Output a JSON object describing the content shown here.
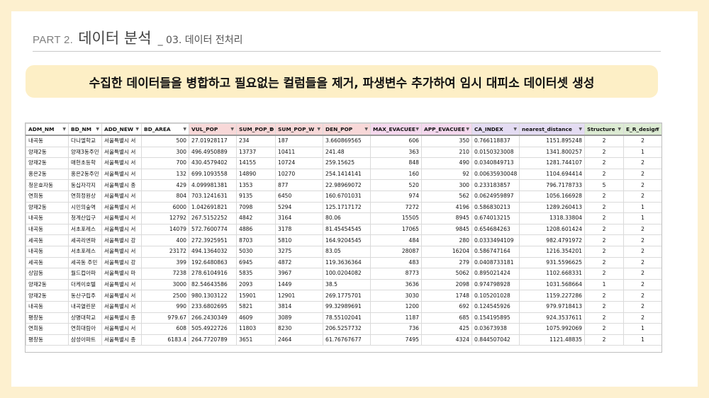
{
  "header": {
    "part": "PART 2.",
    "title": "데이터 분석",
    "subtitle": "_ 03. 데이터 전처리"
  },
  "banner": "수집한 데이터들을 병합하고 필요없는 컬럼들을 제거, 파생변수 추가하여 임시 대피소 데이터셋 생성",
  "table": {
    "columns": [
      {
        "name": "ADM_NM",
        "color": "#ffffff"
      },
      {
        "name": "BD_NM",
        "color": "#ffffff"
      },
      {
        "name": "ADD_NEW",
        "color": "#ffffff"
      },
      {
        "name": "BD_AREA",
        "color": "#ffffff"
      },
      {
        "name": "VUL_POP",
        "color": "#f8d8d8"
      },
      {
        "name": "SUM_POP_D",
        "color": "#f8d8d8"
      },
      {
        "name": "SUM_POP_W",
        "color": "#f8d8d8"
      },
      {
        "name": "DEN_POP",
        "color": "#f8d8d8"
      },
      {
        "name": "MAX_EVACUEE",
        "color": "#f5d8ee"
      },
      {
        "name": "APP_EVACUEE",
        "color": "#f5d8ee"
      },
      {
        "name": "CA_INDEX",
        "color": "#e4dcf3"
      },
      {
        "name": "nearest_distance",
        "color": "#e4dcf3"
      },
      {
        "name": "Structure",
        "color": "#dcebd3"
      },
      {
        "name": "E_R_design",
        "color": "#dcebd3"
      }
    ],
    "rows": [
      [
        "내곡동",
        "다니엘학교",
        "서울특별시 서",
        "500",
        "27.01928117",
        "234",
        "187",
        "3.660869565",
        "606",
        "350",
        "0.766118837",
        "1151.895248",
        "2",
        "2"
      ],
      [
        "양재2동",
        "양재3동주민",
        "서울특별시 서",
        "300",
        "496.4950889",
        "13737",
        "10411",
        "241.48",
        "363",
        "210",
        "0.0150323008",
        "1341.800257",
        "2",
        "1"
      ],
      [
        "양재2동",
        "매헌초등학",
        "서울특별시 서",
        "700",
        "430.4579402",
        "14155",
        "10724",
        "259.15625",
        "848",
        "490",
        "0.0340849713",
        "1281.744107",
        "2",
        "2"
      ],
      [
        "홍은2동",
        "홍은2동주민",
        "서울특별시 서",
        "132",
        "699.1093558",
        "14890",
        "10270",
        "254.1414141",
        "160",
        "92",
        "0.00635930048",
        "1104.694414",
        "2",
        "2"
      ],
      [
        "청운효자동",
        "동십자각지",
        "서울특별시 종",
        "429",
        "4.099981381",
        "1353",
        "877",
        "22.98969072",
        "520",
        "300",
        "0.233183857",
        "796.7178733",
        "5",
        "2"
      ],
      [
        "연희동",
        "연희정원상",
        "서울특별시 서",
        "804",
        "703.1241631",
        "9135",
        "6450",
        "160.6701031",
        "974",
        "562",
        "0.0624959897",
        "1056.166928",
        "2",
        "2"
      ],
      [
        "양재2동",
        "시민의숲역",
        "서울특별시 서",
        "6000",
        "1.042691821",
        "7098",
        "5294",
        "125.1717172",
        "7272",
        "4196",
        "0.586830213",
        "1289.260413",
        "2",
        "1"
      ],
      [
        "내곡동",
        "청계산입구",
        "서울특별시 서",
        "12792",
        "267.5152252",
        "4842",
        "3164",
        "80.06",
        "15505",
        "8945",
        "0.674013215",
        "1318.33804",
        "2",
        "1"
      ],
      [
        "내곡동",
        "서초포레스",
        "서울특별시 서",
        "14079",
        "572.7600774",
        "4886",
        "3178",
        "81.45454545",
        "17065",
        "9845",
        "0.654684263",
        "1208.601424",
        "2",
        "2"
      ],
      [
        "세곡동",
        "세곡리엔파",
        "서울특별시 강",
        "400",
        "272.3925951",
        "8703",
        "5810",
        "164.9204545",
        "484",
        "280",
        "0.0333494109",
        "982.4791972",
        "2",
        "2"
      ],
      [
        "내곡동",
        "서초포레스",
        "서울특별시 서",
        "23172",
        "494.1364032",
        "5030",
        "3275",
        "83.05",
        "28087",
        "16204",
        "0.586747164",
        "1216.354201",
        "2",
        "2"
      ],
      [
        "세곡동",
        "세곡동 주민",
        "서울특별시 강",
        "399",
        "192.6480863",
        "6945",
        "4872",
        "119.3636364",
        "483",
        "279",
        "0.0408733181",
        "931.5596625",
        "2",
        "2"
      ],
      [
        "상암동",
        "월드컵아파",
        "서울특별시 마",
        "7238",
        "278.6104916",
        "5835",
        "3967",
        "100.0204082",
        "8773",
        "5062",
        "0.895021424",
        "1102.668331",
        "2",
        "2"
      ],
      [
        "양재2동",
        "더케이호텔",
        "서울특별시 서",
        "3000",
        "82.54643586",
        "2093",
        "1449",
        "38.5",
        "3636",
        "2098",
        "0.974798928",
        "1031.568664",
        "1",
        "2"
      ],
      [
        "양재2동",
        "동산구립주",
        "서울특별시 서",
        "2500",
        "980.1303122",
        "15901",
        "12901",
        "269.1775701",
        "3030",
        "1748",
        "0.105201028",
        "1159.227286",
        "2",
        "2"
      ],
      [
        "내곡동",
        "내곡열린문",
        "서울특별시 서",
        "990",
        "233.6802695",
        "5821",
        "3814",
        "99.32989691",
        "1200",
        "692",
        "0.124545926",
        "979.9718413",
        "2",
        "2"
      ],
      [
        "평창동",
        "상명대학교",
        "서울특별시 종",
        "979.67",
        "266.2430349",
        "4609",
        "3089",
        "78.55102041",
        "1187",
        "685",
        "0.154195895",
        "924.3537611",
        "2",
        "2"
      ],
      [
        "연희동",
        "연희대림아",
        "서울특별시 서",
        "608",
        "505.4922726",
        "11803",
        "8230",
        "206.5257732",
        "736",
        "425",
        "0.03673938",
        "1075.992069",
        "2",
        "1"
      ],
      [
        "평창동",
        "삼성아파트",
        "서울특별시 종",
        "6183.4",
        "264.7720789",
        "3651",
        "2464",
        "61.76767677",
        "7495",
        "4324",
        "0.844507042",
        "1121.48835",
        "2",
        "1"
      ]
    ]
  }
}
